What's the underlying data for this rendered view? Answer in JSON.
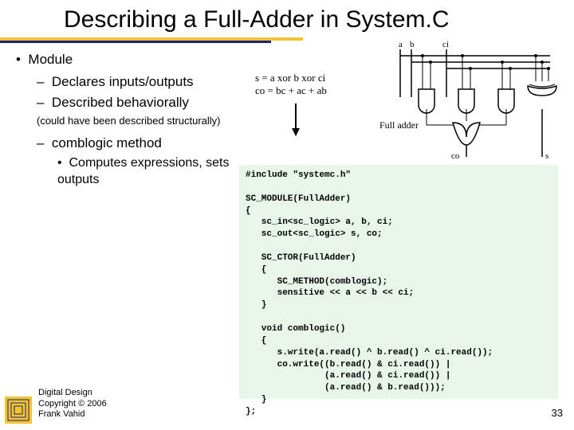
{
  "title": "Describing a Full-Adder in System.C",
  "bullets": {
    "module": "Module",
    "declares": "Declares inputs/outputs",
    "described": "Described behaviorally",
    "could": "(could have been described structurally)",
    "comblogic": "comblogic method",
    "computes": "Computes expressions, sets outputs"
  },
  "equations": {
    "s": "s = a xor b xor ci",
    "co": "co = bc + ac + ab"
  },
  "circuit": {
    "in_a": "a",
    "in_b": "b",
    "in_ci": "ci",
    "label": "Full adder",
    "out_co": "co",
    "out_s": "s"
  },
  "code": "#include \"systemc.h\"\n\nSC_MODULE(FullAdder)\n{\n   sc_in<sc_logic> a, b, ci;\n   sc_out<sc_logic> s, co;\n\n   SC_CTOR(FullAdder)\n   {\n      SC_METHOD(comblogic);\n      sensitive << a << b << ci;\n   }\n\n   void comblogic()\n   {\n      s.write(a.read() ^ b.read() ^ ci.read());\n      co.write((b.read() & ci.read()) |\n               (a.read() & ci.read()) |\n               (a.read() & b.read()));\n   }\n};",
  "footer": {
    "l1": "Digital Design",
    "l2": "Copyright © 2006",
    "l3": "Frank Vahid"
  },
  "pagenum": "33"
}
